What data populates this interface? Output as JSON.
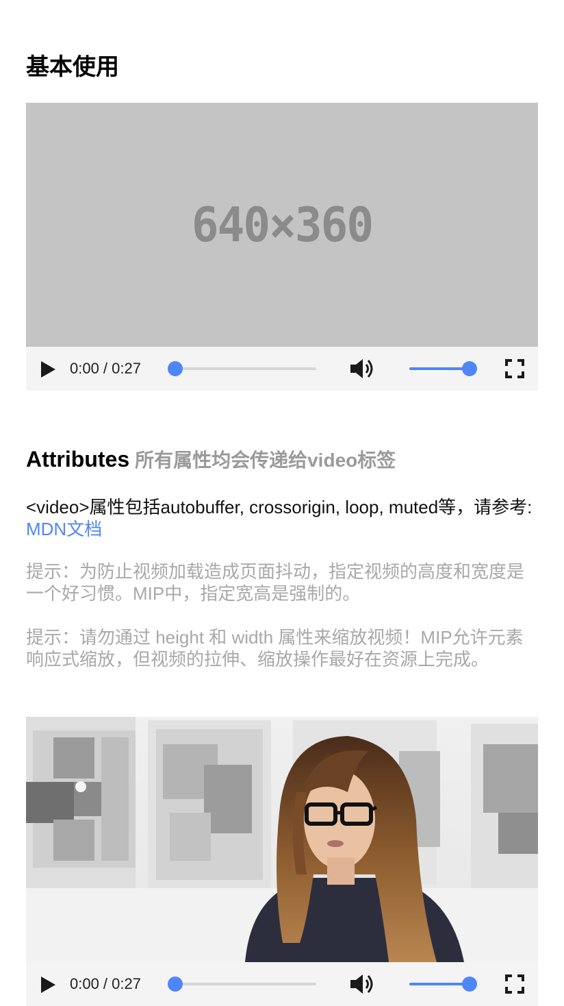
{
  "basic_section": {
    "title": "基本使用"
  },
  "video1": {
    "poster_text": "640×360",
    "time_display": "0:00 / 0:27",
    "progress": 0,
    "volume": 1.0
  },
  "attributes_section": {
    "title": "Attributes",
    "subtitle": "所有属性均会传递给video标签",
    "paragraph1_text": "<video>属性包括autobuffer, crossorigin, loop, muted等，请参考: ",
    "paragraph1_link": "MDN文档",
    "tip1": "提示：为防止视频加载造成页面抖动，指定视频的高度和宽度是一个好习惯。MIP中，指定宽高是强制的。",
    "tip2": "提示：请勿通过 height 和 width 属性来缩放视频！MIP允许元素响应式缩放，但视频的拉伸、缩放操作最好在资源上完成。"
  },
  "video2": {
    "time_display": "0:00 / 0:27",
    "progress": 0,
    "volume": 1.0
  },
  "colors": {
    "accent": "#4f86f7",
    "muted_text": "#a8a8a8",
    "placeholder_bg": "#c4c4c4"
  }
}
